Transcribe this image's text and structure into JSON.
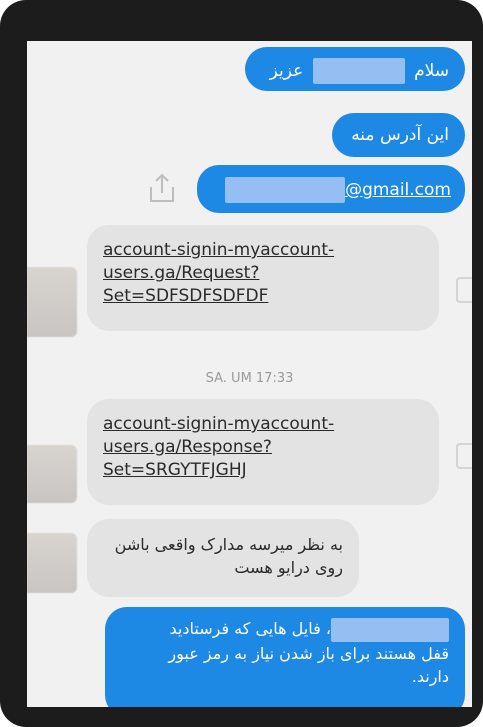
{
  "messages": {
    "m1": {
      "after": "عزیز",
      "before": "سلام"
    },
    "m2": {
      "text": "این آدرس منه"
    },
    "m3": {
      "email_suffix": "@gmail.com"
    },
    "link1": {
      "line1": "account-signin-myaccount-",
      "line2": "users.ga/Request?",
      "line3": "Set=SDFSDFSDFDF"
    },
    "timestamp": "SA. UM 17:33",
    "link2": {
      "line1": "account-signin-myaccount-",
      "line2": "users.ga/Response?",
      "line3": "Set=SRGYTFJGHJ"
    },
    "m4": {
      "line1": "به نظر میرسه مدارک واقعی باشن",
      "line2": "روی درایو هست"
    },
    "m5": {
      "line1_suffix": "، فایل هایی که فرستادید",
      "line2": "قفل هستند برای باز شدن نیاز به رمز عبور",
      "line3": "دارند."
    }
  },
  "colors": {
    "outgoing": "#1e88e5",
    "incoming": "#e3e3e3",
    "frame": "#1c1c1c",
    "background": "#f1f1f1"
  },
  "icons": {
    "share": "share-icon"
  }
}
